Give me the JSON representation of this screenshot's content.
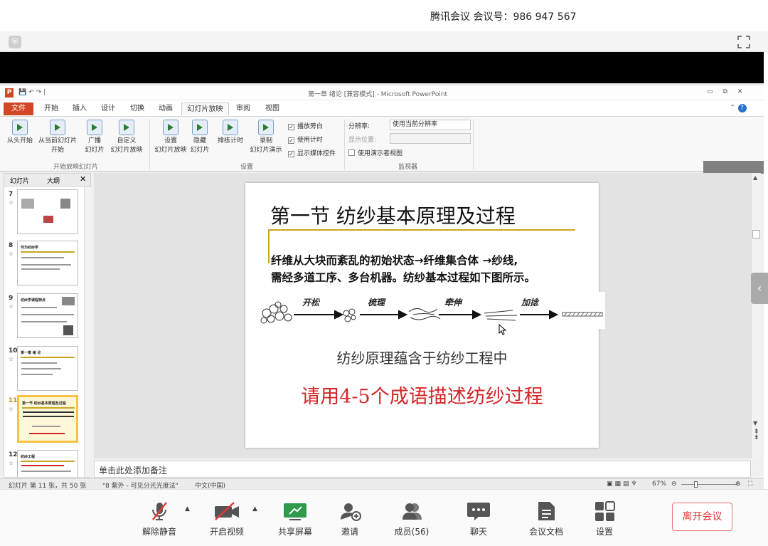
{
  "window": {
    "meeting_title": "腾讯会议 会议号：986 947 567"
  },
  "ppt": {
    "title": "第一章 绪论 [兼容模式] - Microsoft PowerPoint",
    "tabs": [
      "文件",
      "开始",
      "插入",
      "设计",
      "切换",
      "动画",
      "幻灯片放映",
      "审阅",
      "视图"
    ],
    "ribbon": {
      "start_group": "开始放映幻灯片",
      "setup_group": "设置",
      "monitor_group": "监视器",
      "from_start": "从头开始",
      "from_current": "从当前幻灯片\n开始",
      "broadcast": "广播\n幻灯片",
      "custom": "自定义\n幻灯片放映",
      "setup_show": "设置\n幻灯片放映",
      "hide_slide": "隐藏\n幻灯片",
      "rehearse": "排练计时",
      "record": "录制\n幻灯片演示",
      "chk_narration": "播放旁白",
      "chk_timing": "使用计时",
      "chk_media": "显示媒体控件",
      "resolution_label": "分辨率:",
      "resolution_value": "使用当前分辨率",
      "show_on_label": "显示位置:",
      "presenter_view": "使用演示者视图"
    },
    "pane": {
      "tab_slides": "幻灯片",
      "tab_outline": "大纲",
      "close": "✕"
    },
    "thumbs": [
      {
        "num": "7",
        "title": ""
      },
      {
        "num": "8",
        "title": "何为纺纱学"
      },
      {
        "num": "9",
        "title": "纺纱学课程特点"
      },
      {
        "num": "10",
        "title": "第一章 绪 论"
      },
      {
        "num": "11",
        "title": "第一节 纺纱基本原理及过程"
      },
      {
        "num": "12",
        "title": "纺纱工程"
      }
    ],
    "slide": {
      "title": "第一节 纺纱基本原理及过程",
      "line1": "纤维从大块而紊乱的初始状态→纤维集合体 →纱线,",
      "line2": "需经多道工序、多台机器。纺纱基本过程如下图所示。",
      "steps": [
        "开松",
        "梳理",
        "牵伸",
        "加捻"
      ],
      "principle": "纺纱原理蕴含于纺纱工程中",
      "prompt": "请用4-5个成语描述纺纱过程"
    },
    "notes_placeholder": "单击此处添加备注",
    "status": {
      "slide_pos": "幻灯片 第 11 张，共 50 张",
      "theme": "\"8 紫外 - 可见分光光度法\"",
      "language": "中文(中国)",
      "zoom": "67%"
    }
  },
  "toolbar": {
    "unmute": "解除静音",
    "video": "开启视频",
    "share": "共享屏幕",
    "invite": "邀请",
    "members": "成员(56)",
    "chat": "聊天",
    "docs": "会议文档",
    "settings": "设置",
    "leave": "离开会议"
  }
}
